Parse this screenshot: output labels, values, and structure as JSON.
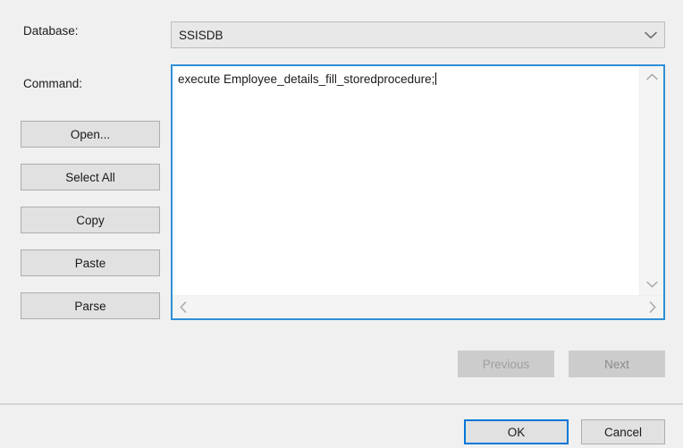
{
  "dialog": {
    "background_color": "#f0f0f0"
  },
  "database_field": {
    "label": "Database:",
    "selected_value": "SSISDB",
    "dropdown_icon": "chevron-down-icon"
  },
  "command_field": {
    "label": "Command:",
    "value": "execute Employee_details_fill_storedprocedure;",
    "focus_border_color": "#2e8fd6",
    "vertical_scrollbar": {
      "up_icon": "chevron-up-icon",
      "down_icon": "chevron-down-icon"
    },
    "horizontal_scrollbar": {
      "left_icon": "chevron-left-icon",
      "right_icon": "chevron-right-icon"
    }
  },
  "side_buttons": [
    {
      "label": "Open...",
      "name": "open-button"
    },
    {
      "label": "Select All",
      "name": "select-all-button"
    },
    {
      "label": "Copy",
      "name": "copy-button"
    },
    {
      "label": "Paste",
      "name": "paste-button"
    },
    {
      "label": "Parse",
      "name": "parse-button"
    }
  ],
  "navigation": {
    "previous_label": "Previous",
    "next_label": "Next",
    "disabled": true
  },
  "footer": {
    "ok_label": "OK",
    "cancel_label": "Cancel",
    "default_button": "OK",
    "default_border_color": "#0078d7"
  }
}
